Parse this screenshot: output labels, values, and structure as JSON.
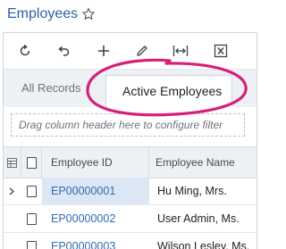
{
  "header": {
    "title": "Employees",
    "favorite_icon": "star-icon"
  },
  "toolbar": {
    "buttons": [
      {
        "name": "refresh-icon"
      },
      {
        "name": "undo-icon"
      },
      {
        "name": "add-icon"
      },
      {
        "name": "edit-icon"
      },
      {
        "name": "fit-to-screen-icon"
      },
      {
        "name": "export-excel-icon"
      }
    ]
  },
  "tabs": {
    "all_records": "All Records",
    "active_employees": "Active Employees"
  },
  "filter": {
    "placeholder": "Drag column header here to configure filter"
  },
  "grid": {
    "columns": {
      "employee_id": "Employee ID",
      "employee_name": "Employee Name"
    },
    "rows": [
      {
        "id": "EP00000001",
        "name": "Hu Ming, Mrs.",
        "selected": true
      },
      {
        "id": "EP00000002",
        "name": "User Admin, Ms.",
        "selected": false
      },
      {
        "id": "EP00000003",
        "name": "Wilson Lesley, Ms.",
        "selected": false
      }
    ]
  },
  "colors": {
    "accent": "#2c5fa6",
    "link": "#2f6db3",
    "highlight_ellipse": "#d6217a",
    "selected_row": "#dce6f4"
  }
}
